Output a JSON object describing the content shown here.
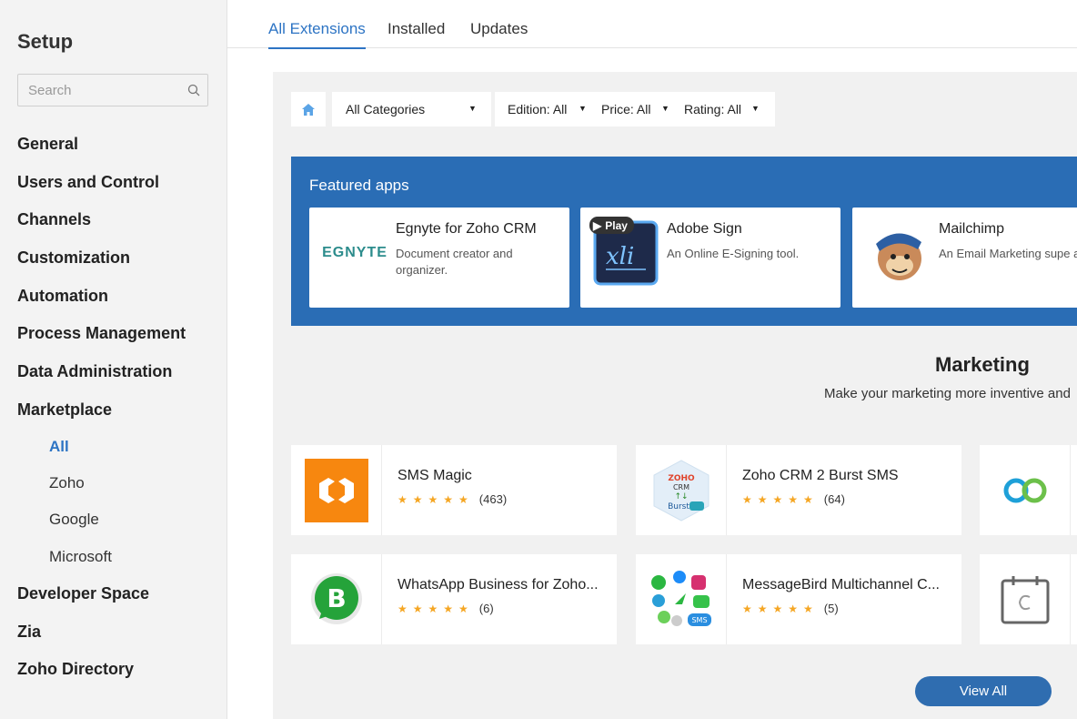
{
  "sidebar": {
    "title": "Setup",
    "search_placeholder": "Search",
    "items": {
      "general": "General",
      "users": "Users and Control",
      "channels": "Channels",
      "customization": "Customization",
      "automation": "Automation",
      "process": "Process Management",
      "data_admin": "Data Administration",
      "marketplace": "Marketplace",
      "developer": "Developer Space",
      "zia": "Zia",
      "directory": "Zoho Directory"
    },
    "marketplace_sub": {
      "all": "All",
      "zoho": "Zoho",
      "google": "Google",
      "microsoft": "Microsoft"
    }
  },
  "tabs": {
    "all": "All Extensions",
    "installed": "Installed",
    "updates": "Updates"
  },
  "filters": {
    "category": "All Categories",
    "edition": "Edition: All",
    "price": "Price: All",
    "rating": "Rating: All"
  },
  "featured": {
    "title": "Featured apps",
    "apps": [
      {
        "name": "Egnyte for Zoho CRM",
        "desc": "Document creator and organizer.",
        "logo_text": "EGNYTE"
      },
      {
        "name": "Adobe Sign",
        "desc": "An Online E-Signing tool.",
        "badge": "Play"
      },
      {
        "name": "Mailchimp",
        "desc": "An Email Marketing supe app."
      }
    ]
  },
  "section": {
    "title": "Marketing",
    "subtitle": "Make your marketing more inventive and"
  },
  "apps": [
    {
      "name": "SMS Magic",
      "stars": "★★★★★",
      "count": "(463)"
    },
    {
      "name": "Zoho CRM 2 Burst SMS",
      "stars": "★★★★★",
      "count": "(64)"
    },
    {
      "name": "WhatsApp Business for Zoho...",
      "stars": "★★★★★",
      "count": "(6)"
    },
    {
      "name": "MessageBird Multichannel C...",
      "stars": "★★★★★",
      "count": "(5)"
    }
  ],
  "view_all": "View All",
  "colors": {
    "accent": "#2d74c4",
    "featured_bg": "#2a6db5",
    "star": "#f5a623"
  }
}
